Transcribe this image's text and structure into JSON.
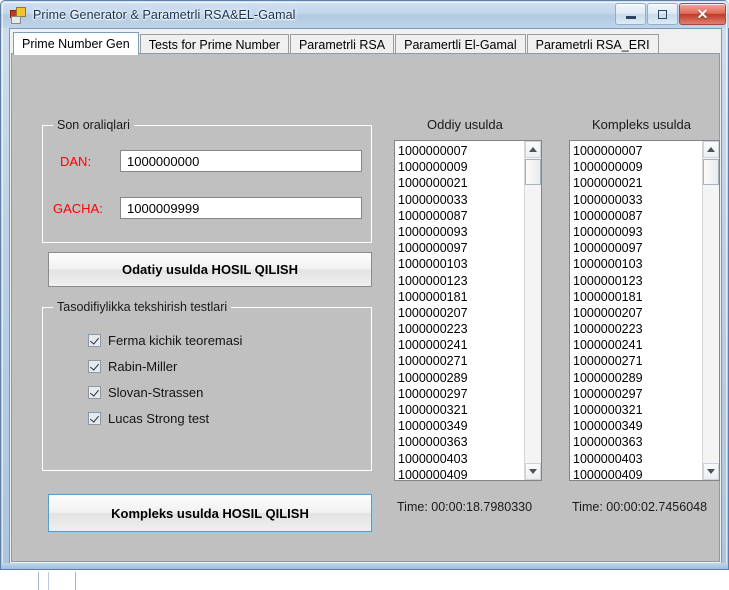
{
  "window": {
    "title": "Prime Generator & Parametrli RSA&EL-Gamal",
    "icon": "app-icon",
    "caption": {
      "minimize_label": "–",
      "maximize_label": "□",
      "close_label": "✕"
    }
  },
  "tabs": [
    {
      "label": "Prime Number Gen",
      "active": true
    },
    {
      "label": "Tests for Prime Number",
      "active": false
    },
    {
      "label": "Parametrli RSA",
      "active": false
    },
    {
      "label": "Paramertli El-Gamal",
      "active": false
    },
    {
      "label": "Parametrli RSA_ERI",
      "active": false
    }
  ],
  "range_group": {
    "title": "Son oraliqlari",
    "from_label": "DAN:",
    "from_value": "1000000000",
    "to_label": "GACHA:",
    "to_value": "1000009999",
    "label_color": "#ff0000"
  },
  "buttons": {
    "simple_generate": "Odatiy usulda HOSIL QILISH",
    "complex_generate": "Kompleks usulda HOSIL QILISH",
    "focus_color": "#5a9bc8"
  },
  "tests_group": {
    "title": "Tasodifiylikka tekshirish testlari",
    "items": [
      {
        "label": "Ferma kichik teoremasi",
        "checked": true
      },
      {
        "label": "Rabin-Miller",
        "checked": true
      },
      {
        "label": "Slovan-Strassen",
        "checked": true
      },
      {
        "label": "Lucas Strong test",
        "checked": true
      }
    ]
  },
  "results": {
    "left": {
      "header": "Oddiy usulda",
      "time_label": "Time: 00:00:18.7980330",
      "items": [
        "1000000007",
        "1000000009",
        "1000000021",
        "1000000033",
        "1000000087",
        "1000000093",
        "1000000097",
        "1000000103",
        "1000000123",
        "1000000181",
        "1000000207",
        "1000000223",
        "1000000241",
        "1000000271",
        "1000000289",
        "1000000297",
        "1000000321",
        "1000000349",
        "1000000363",
        "1000000403",
        "1000000409"
      ]
    },
    "right": {
      "header": "Kompleks usulda",
      "time_label": "Time: 00:00:02.7456048",
      "items": [
        "1000000007",
        "1000000009",
        "1000000021",
        "1000000033",
        "1000000087",
        "1000000093",
        "1000000097",
        "1000000103",
        "1000000123",
        "1000000181",
        "1000000207",
        "1000000223",
        "1000000241",
        "1000000271",
        "1000000289",
        "1000000297",
        "1000000321",
        "1000000349",
        "1000000363",
        "1000000403",
        "1000000409"
      ]
    }
  }
}
